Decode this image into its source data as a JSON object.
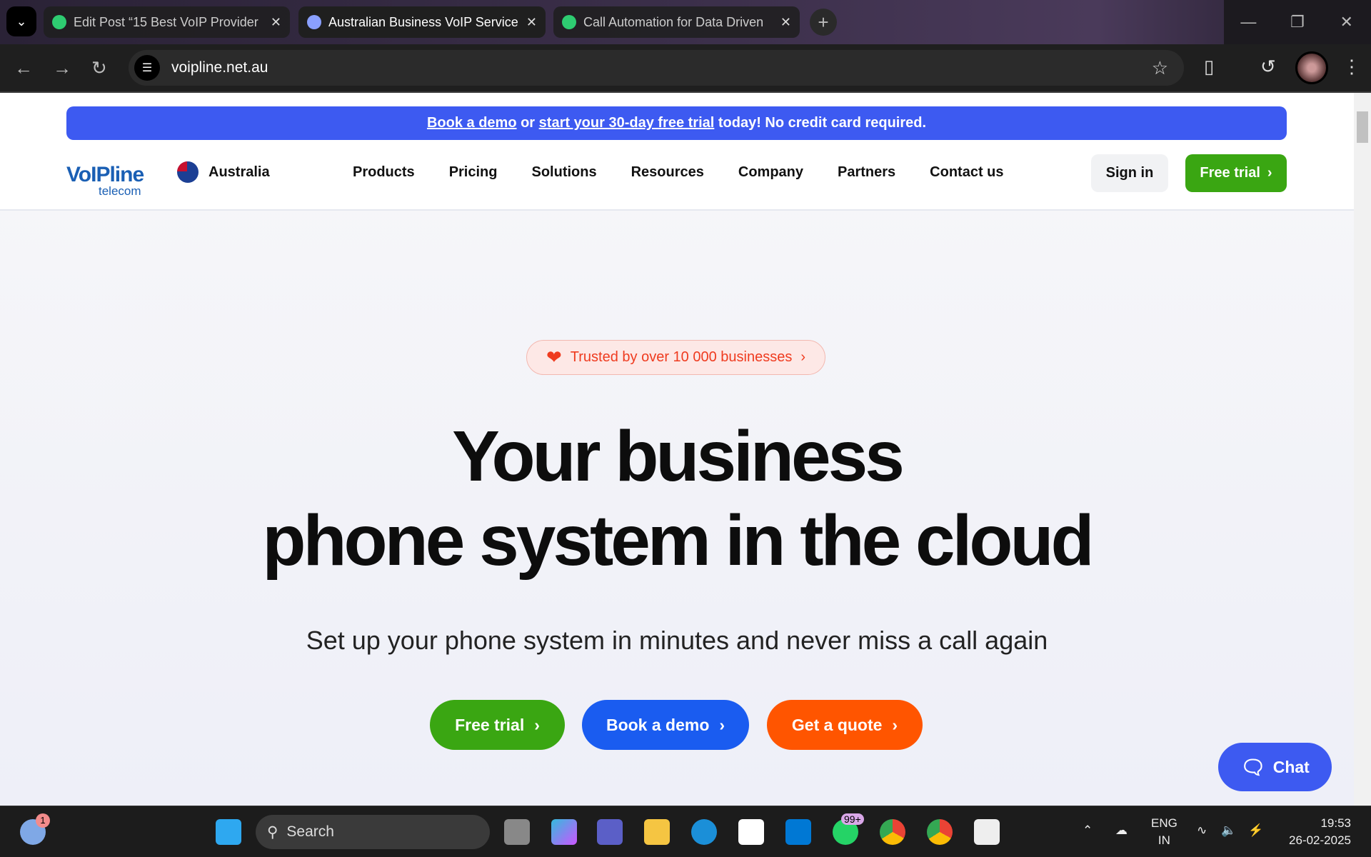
{
  "browser": {
    "tabs": [
      {
        "title": "Edit Post “15 Best VoIP Provider",
        "favicon_color": "#2ecc71",
        "active": false
      },
      {
        "title": "Australian Business VoIP Service",
        "favicon_color": "#8aa0ff",
        "active": true
      },
      {
        "title": "Call Automation for Data Driven",
        "favicon_color": "#2ecc71",
        "active": false
      }
    ],
    "url": "voipline.net.au"
  },
  "banner": {
    "link1": "Book a demo",
    "mid": " or ",
    "link2": "start your 30-day free trial",
    "tail": " today! No credit card required."
  },
  "header": {
    "logo_main": "VoIPline",
    "logo_sub": "telecom",
    "country": "Australia",
    "nav": [
      "Products",
      "Pricing",
      "Solutions",
      "Resources",
      "Company",
      "Partners",
      "Contact us"
    ],
    "sign_in": "Sign in",
    "free_trial": "Free trial"
  },
  "hero": {
    "badge": "Trusted by over 10 000 businesses",
    "title_line1": "Your business",
    "title_line2": "phone system in the cloud",
    "subtitle": "Set up your phone system in minutes and never miss a call again",
    "buttons": [
      {
        "label": "Free trial",
        "color": "#3aa612"
      },
      {
        "label": "Book a demo",
        "color": "#1a5cf0"
      },
      {
        "label": "Get a quote",
        "color": "#ff5500"
      }
    ]
  },
  "chat": {
    "label": "Chat"
  },
  "taskbar": {
    "weather_badge": "1",
    "search": "Search",
    "whatsapp_badge": "99+",
    "lang1": "ENG",
    "lang2": "IN",
    "time": "19:53",
    "date": "26-02-2025"
  }
}
